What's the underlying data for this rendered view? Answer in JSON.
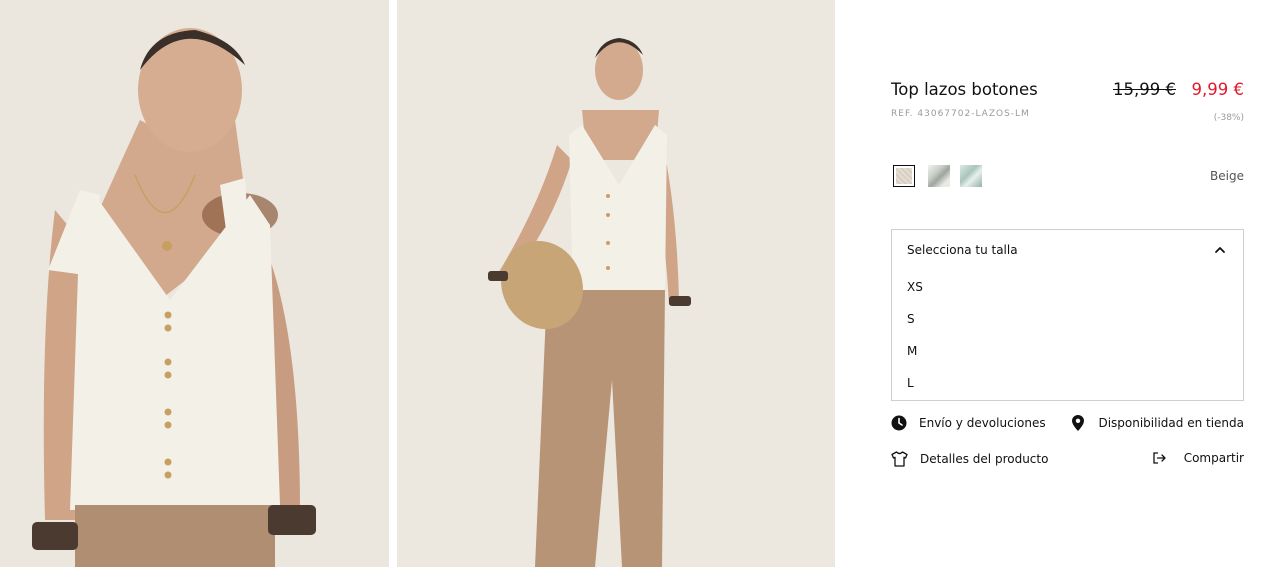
{
  "product": {
    "title": "Top lazos botones",
    "ref": "REF. 43067702-LAZOS-LM",
    "old_price": "15,99 €",
    "new_price": "9,99 €",
    "discount": "(-38%)",
    "selected_color": "Beige"
  },
  "swatches": [
    {
      "name": "beige",
      "selected": true
    },
    {
      "name": "print-grey"
    },
    {
      "name": "print-mint"
    }
  ],
  "size_selector": {
    "header": "Selecciona tu talla",
    "options": [
      "XS",
      "S",
      "M",
      "L"
    ]
  },
  "links": {
    "shipping": "Envío y devoluciones",
    "store_availability": "Disponibilidad en tienda",
    "product_details": "Detalles del producto",
    "share": "Compartir"
  },
  "colors": {
    "sale_price": "#e3192c",
    "muted_text": "#9a9a9a",
    "border": "#cfcfcf"
  },
  "icons": {
    "shipping": "clock-icon",
    "store_availability": "location-pin-icon",
    "product_details": "tshirt-icon",
    "share": "share-arrow-icon"
  }
}
